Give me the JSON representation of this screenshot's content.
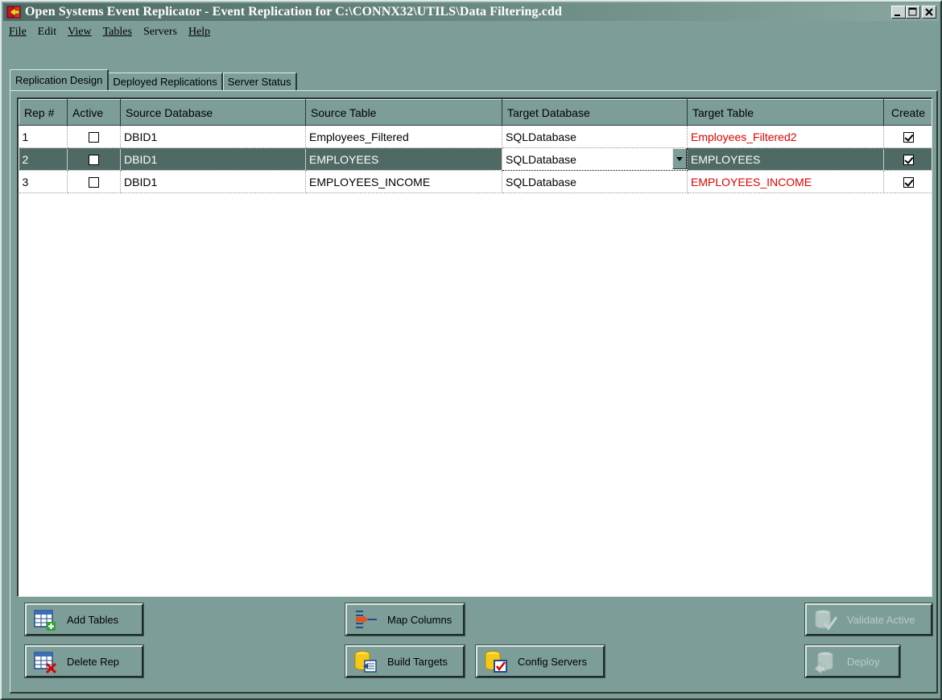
{
  "window": {
    "title": "Open Systems Event Replicator - Event Replication for C:\\CONNX32\\UTILS\\Data Filtering.cdd"
  },
  "menu": [
    "File",
    "Edit",
    "View",
    "Tables",
    "Servers",
    "Help"
  ],
  "tabs": [
    {
      "label": "Replication Design",
      "active": true
    },
    {
      "label": "Deployed Replications",
      "active": false
    },
    {
      "label": "Server Status",
      "active": false
    }
  ],
  "grid": {
    "headers": {
      "rep": "Rep #",
      "active": "Active",
      "source_db": "Source Database",
      "source_table": "Source Table",
      "target_db": "Target Database",
      "target_table": "Target Table",
      "create": "Create"
    },
    "rows": [
      {
        "rep": "1",
        "active": false,
        "source_db": "DBID1",
        "source_table": "Employees_Filtered",
        "target_db": "SQLDatabase",
        "target_table": "Employees_Filtered2",
        "create": true
      },
      {
        "rep": "2",
        "active": false,
        "source_db": "DBID1",
        "source_table": "EMPLOYEES",
        "target_db": "SQLDatabase",
        "target_table": "EMPLOYEES",
        "create": true
      },
      {
        "rep": "3",
        "active": false,
        "source_db": "DBID1",
        "source_table": "EMPLOYEES_INCOME",
        "target_db": "SQLDatabase",
        "target_table": "EMPLOYEES_INCOME",
        "create": true
      }
    ],
    "selected_row": 2
  },
  "buttons": {
    "add_tables": "Add Tables",
    "delete_rep": "Delete Rep",
    "map_columns": "Map Columns",
    "build_targets": "Build Targets",
    "config_servers": "Config Servers",
    "validate_active": "Validate Active",
    "deploy": "Deploy"
  },
  "colors": {
    "chrome": "#7d9e98",
    "selection": "#4f6964",
    "warning_text": "#e00000"
  }
}
